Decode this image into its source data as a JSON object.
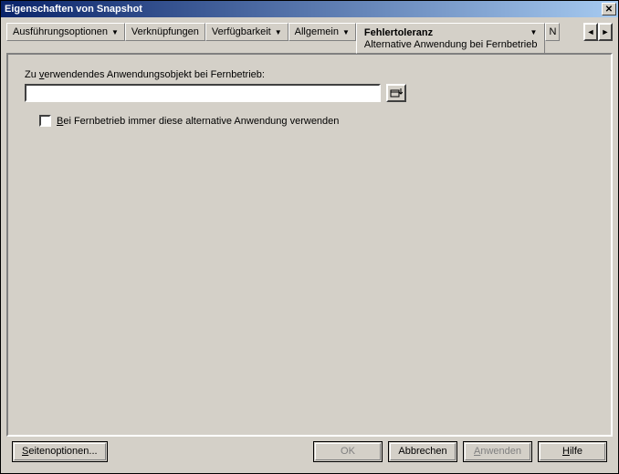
{
  "window": {
    "title": "Eigenschaften von Snapshot",
    "close_glyph": "✕"
  },
  "tabs": {
    "items": [
      {
        "label": "Ausführungsoptionen",
        "has_menu": true
      },
      {
        "label": "Verknüpfungen",
        "has_menu": false
      },
      {
        "label": "Verfügbarkeit",
        "has_menu": true
      },
      {
        "label": "Allgemein",
        "has_menu": true
      }
    ],
    "active": {
      "label": "Fehlertoleranz",
      "sub": "Alternative Anwendung bei Fernbetrieb"
    },
    "overflow": "N"
  },
  "panel": {
    "field_label_pre": "Zu ",
    "field_label_ul": "v",
    "field_label_post": "erwendendes Anwendungsobjekt bei Fernbetrieb:",
    "input_value": "",
    "checkbox_ul": "B",
    "checkbox_label_post": "ei Fernbetrieb immer diese alternative Anwendung verwenden",
    "checkbox_checked": false
  },
  "buttons": {
    "page_options_ul": "S",
    "page_options_post": "eitenoptionen...",
    "ok": "OK",
    "cancel": "Abbrechen",
    "apply_ul": "A",
    "apply_post": "nwenden",
    "help_ul": "H",
    "help_post": "ilfe"
  }
}
